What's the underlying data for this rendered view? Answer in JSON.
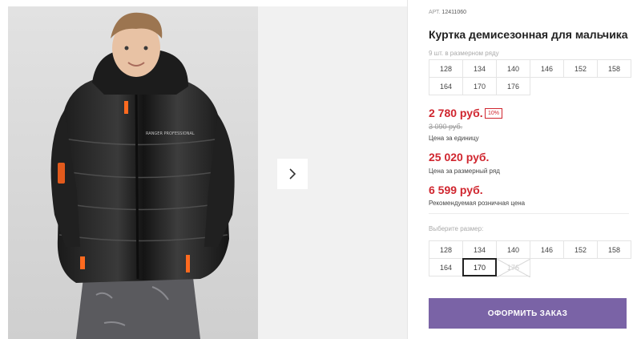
{
  "gallery": {
    "main_image": "boy-in-black-puffer-jacket-photo",
    "jacket_print": "RANGER PROFESSIONAL",
    "next_icon": "chevron-right-icon"
  },
  "product": {
    "article_label": "АРТ.",
    "article_value": "12411060",
    "title": "Куртка демисезонная для мальчика",
    "pack_label": "9 шт. в размерном ряду",
    "pack_sizes": [
      "128",
      "134",
      "140",
      "146",
      "152",
      "158",
      "164",
      "170",
      "176"
    ],
    "price": "2 780 руб.",
    "discount": "10%",
    "old_price": "3 090 руб.",
    "price_note": "Цена за единицу",
    "series_price": "25 020 руб.",
    "series_note": "Цена за размерный ряд",
    "rrp_price": "6 599 руб.",
    "rrp_note": "Рекомендуемая розничная цена"
  },
  "size_selector": {
    "label": "Выберите размер:",
    "sizes": [
      "128",
      "134",
      "140",
      "146",
      "152",
      "158",
      "164",
      "170",
      "176"
    ],
    "selected": "170",
    "unavailable": [
      "176"
    ]
  },
  "order_button": {
    "label": "ОФОРМИТЬ ЗАКАЗ"
  },
  "colors": {
    "accent": "#7a63a6",
    "price_red": "#d0262f",
    "border": "#e4e4e4"
  }
}
